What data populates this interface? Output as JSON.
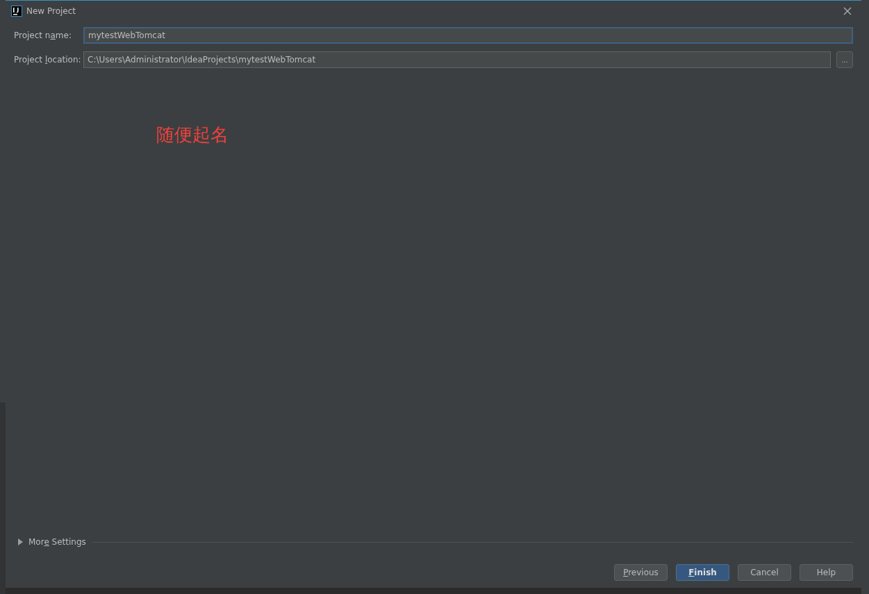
{
  "window": {
    "title": "New Project"
  },
  "fields": [
    {
      "label_parts": [
        {
          "text": "Project n",
          "underline": false
        },
        {
          "text": "a",
          "underline": true
        },
        {
          "text": "me:",
          "underline": false
        }
      ],
      "value": "mytestWebTomcat",
      "focused": true,
      "browse": false
    },
    {
      "label_parts": [
        {
          "text": "Project ",
          "underline": false
        },
        {
          "text": "l",
          "underline": true
        },
        {
          "text": "ocation:",
          "underline": false
        }
      ],
      "value": "C:\\Users\\Administrator\\IdeaProjects\\mytestWebTomcat",
      "focused": false,
      "browse": true,
      "browse_label": "..."
    }
  ],
  "annotation": "随便起名",
  "more_settings": {
    "label_parts": [
      {
        "text": "Mor",
        "underline": false
      },
      {
        "text": "e",
        "underline": true
      },
      {
        "text": " Settings",
        "underline": false
      }
    ],
    "expanded": false
  },
  "buttons": [
    {
      "label_parts": [
        {
          "text": "P",
          "underline": true
        },
        {
          "text": "revious",
          "underline": false
        }
      ],
      "kind": "default"
    },
    {
      "label_parts": [
        {
          "text": "F",
          "underline": true
        },
        {
          "text": "inish",
          "underline": false
        }
      ],
      "kind": "primary"
    },
    {
      "label_parts": [
        {
          "text": "Cancel",
          "underline": false
        }
      ],
      "kind": "default"
    },
    {
      "label_parts": [
        {
          "text": "Help",
          "underline": false
        }
      ],
      "kind": "default"
    }
  ]
}
